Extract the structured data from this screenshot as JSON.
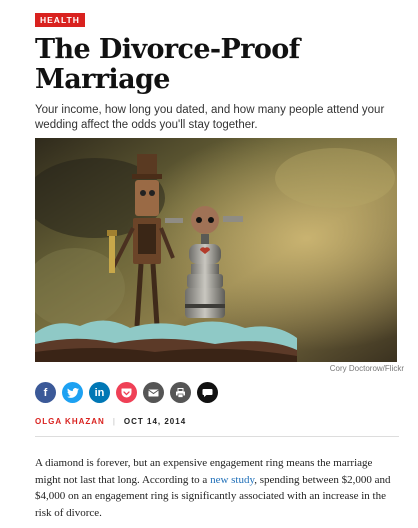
{
  "section_tag": "HEALTH",
  "headline": "The Divorce-Proof Marriage",
  "dek": "Your income, how long you dated, and how many people attend your wedding affect the odds you'll stay together.",
  "photo_credit": "Cory Doctorow/Flickr",
  "share": {
    "buttons": [
      {
        "name": "facebook",
        "color": "#3b5998",
        "glyph": "f"
      },
      {
        "name": "twitter",
        "color": "#1da1f2",
        "glyph": "twitter-bird-icon"
      },
      {
        "name": "linkedin",
        "color": "#0077b5",
        "glyph": "in"
      },
      {
        "name": "pocket",
        "color": "#ef4056",
        "glyph": "pocket-icon"
      },
      {
        "name": "email",
        "color": "#555555",
        "glyph": "envelope-icon"
      },
      {
        "name": "print",
        "color": "#555555",
        "glyph": "printer-icon"
      },
      {
        "name": "comments",
        "color": "#111111",
        "glyph": "speech-bubble-icon"
      }
    ]
  },
  "byline": {
    "author": "OLGA KHAZAN",
    "separator": "|",
    "date": "OCT 14, 2014"
  },
  "body": {
    "p1_before_link": "A diamond is forever, but an expensive engagement ring means the marriage might not last that long. According to a ",
    "p1_link": "new study",
    "p1_after_link": ", spending between $2,000 and $4,000 on an engagement ring is significantly associated with an increase in the risk of divorce."
  }
}
